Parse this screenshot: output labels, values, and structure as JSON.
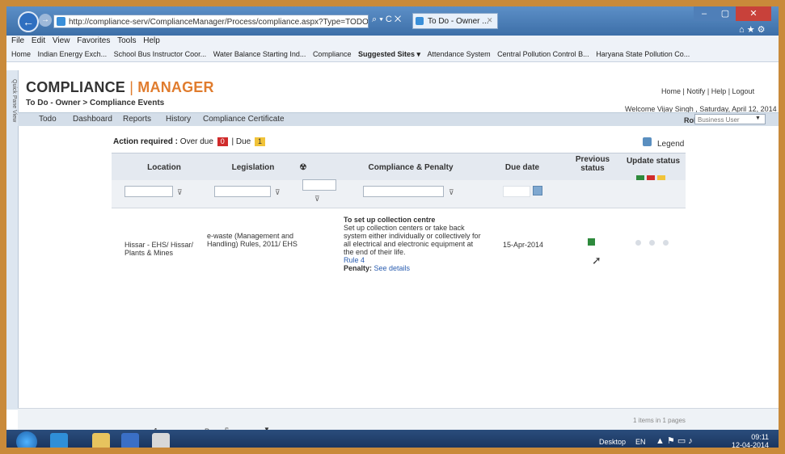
{
  "browser": {
    "url": "http://compliance-serv/ComplianceManager/Process/compliance.aspx?Type=TODO",
    "addr_controls": "⌕ ▾ C ✕",
    "tab_title": "To Do - Owner ...",
    "tab_close": "✕",
    "window_min": "–",
    "window_max": "▢",
    "window_close": "✕",
    "tools_icons": "⌂ ★ ⚙",
    "back_glyph": "←",
    "forward_glyph": "→"
  },
  "menu": [
    "File",
    "Edit",
    "View",
    "Favorites",
    "Tools",
    "Help"
  ],
  "favorites": [
    "Home",
    "Indian Energy Exch...",
    "School Bus Instructor Coor...",
    "Water Balance Starting Ind...",
    "Compliance",
    "Suggested Sites ▾",
    "Attendance System",
    "Central Pollution Control B...",
    "Haryana State Pollution Co..."
  ],
  "app": {
    "brand_a": "COMPLIANCE",
    "brand_sep": "|",
    "brand_b": "MANAGER",
    "breadcrumb": "To Do - Owner > Compliance Events",
    "top_links": "Home  |  Notify  |  Help  |  Logout",
    "welcome": "Welcome Vijay Singh , Saturday, April 12, 2014",
    "tabs": [
      "Todo",
      "Dashboard",
      "Reports",
      "History",
      "Compliance Certificate"
    ],
    "role_label": "Role",
    "role_value": "Business User",
    "side_panel": "Quick Pane View"
  },
  "action_bar": {
    "label": "Action required :",
    "overdue_label": "Over due",
    "overdue_count": "0",
    "due_label": "| Due",
    "due_count": "1",
    "legend": "Legend"
  },
  "table": {
    "headers": {
      "location": "Location",
      "legislation": "Legislation",
      "compliance": "Compliance & Penalty",
      "due_date": "Due date",
      "previous_status": "Previous status",
      "update_status": "Update status"
    },
    "filter_icon": "⊽",
    "row": {
      "location": "Hissar - EHS/ Hissar/ Plants & Mines",
      "legislation": "e-waste (Management and Handling) Rules, 2011/ EHS",
      "comp_title": "To set up collection centre",
      "comp_desc": "Set up collection centers or take back system either individually or collectively for all electrical and electronic equipment at the end of their life.",
      "rule": "Rule 4",
      "penalty_label": "Penalty:",
      "penalty_link": "See details",
      "due_date": "15-Apr-2014"
    }
  },
  "pager": {
    "page": "1",
    "page_size_label": "Page size:",
    "page_size_value": "5",
    "items_info": "1 items in 1 pages"
  },
  "taskbar": {
    "desktop": "Desktop",
    "lang": "EN",
    "time": "09:11",
    "date": "12-04-2014"
  },
  "colors": {
    "accent": "#e07c2e",
    "overdue": "#d02b2b",
    "due": "#f1c339",
    "complied": "#2e8a3c"
  }
}
